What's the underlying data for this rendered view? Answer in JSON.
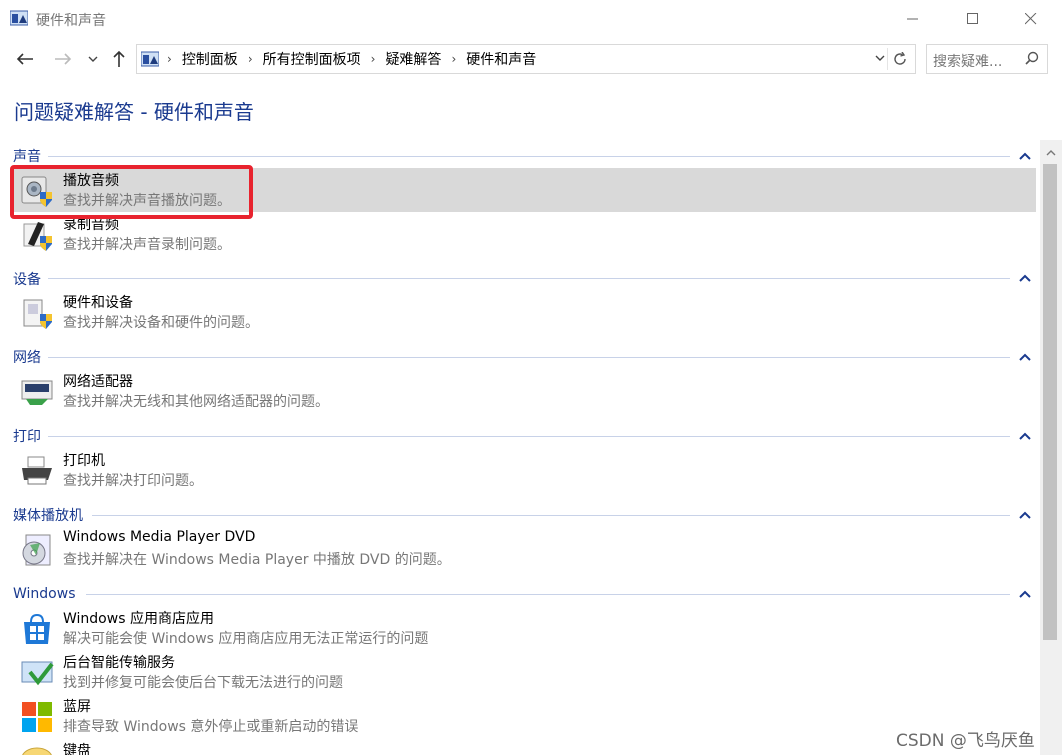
{
  "window": {
    "title": "硬件和声音",
    "icon": "control-panel-icon"
  },
  "address": {
    "crumbs": [
      "控制面板",
      "所有控制面板项",
      "疑难解答",
      "硬件和声音"
    ],
    "search_placeholder": "搜索疑难..."
  },
  "page": {
    "title": "问题疑难解答 - 硬件和声音"
  },
  "sections": [
    {
      "label": "声音",
      "items": [
        {
          "name": "播放音频",
          "desc": "查找并解决声音播放问题。",
          "icon": "speaker-shield-icon",
          "selected": true
        },
        {
          "name": "录制音频",
          "desc": "查找并解决声音录制问题。",
          "icon": "microphone-shield-icon"
        }
      ]
    },
    {
      "label": "设备",
      "items": [
        {
          "name": "硬件和设备",
          "desc": "查找并解决设备和硬件的问题。",
          "icon": "hardware-shield-icon"
        }
      ]
    },
    {
      "label": "网络",
      "items": [
        {
          "name": "网络适配器",
          "desc": "查找并解决无线和其他网络适配器的问题。",
          "icon": "network-adapter-icon"
        }
      ]
    },
    {
      "label": "打印",
      "items": [
        {
          "name": "打印机",
          "desc": "查找并解决打印问题。",
          "icon": "printer-icon"
        }
      ]
    },
    {
      "label": "媒体播放机",
      "items": [
        {
          "name": "Windows Media Player DVD",
          "desc": "查找并解决在 Windows Media Player 中播放 DVD 的问题。",
          "icon": "dvd-icon"
        }
      ]
    },
    {
      "label": "Windows",
      "items": [
        {
          "name": "Windows 应用商店应用",
          "desc": "解决可能会使 Windows 应用商店应用无法正常运行的问题",
          "icon": "store-icon"
        },
        {
          "name": "后台智能传输服务",
          "desc": "找到并修复可能会使后台下载无法进行的问题",
          "icon": "bits-icon"
        },
        {
          "name": "蓝屏",
          "desc": "排查导致 Windows 意外停止或重新启动的错误",
          "icon": "windows-logo-icon"
        },
        {
          "name": "键盘",
          "desc": "",
          "icon": "keyboard-icon"
        }
      ]
    }
  ],
  "watermark": "CSDN @飞鸟厌鱼",
  "colors": {
    "heading": "#1a3a8f",
    "selected_bg": "#d9d9d9",
    "highlight": "#e8232e"
  }
}
